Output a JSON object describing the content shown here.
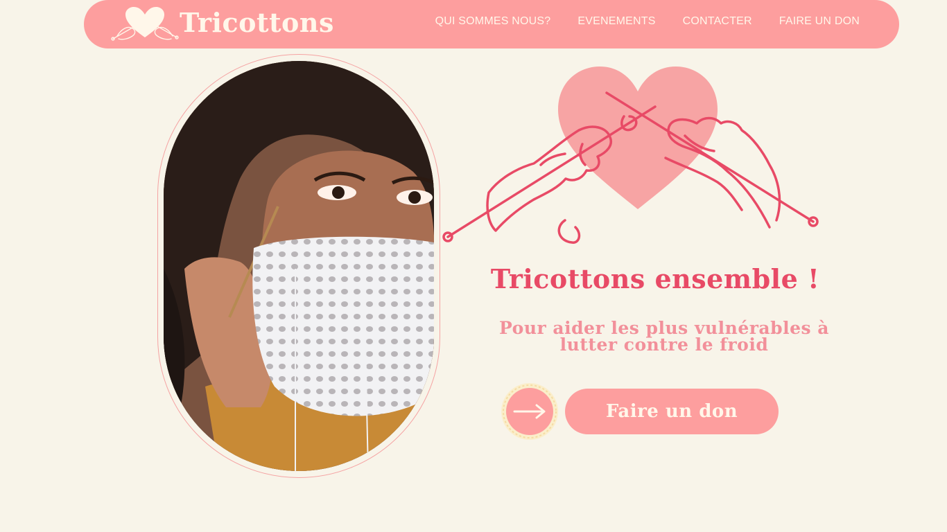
{
  "header": {
    "brand": "Tricottons",
    "nav": [
      {
        "label": "QUI SOMMES NOUS?"
      },
      {
        "label": "EVENEMENTS"
      },
      {
        "label": "CONTACTER"
      },
      {
        "label": "FAIRE UN DON"
      }
    ]
  },
  "hero": {
    "title": "Tricottons ensemble !",
    "subtitle": "Pour aider les plus vulnérables à lutter contre le froid",
    "cta_label": "Faire un don",
    "arrow_icon": "arrow-right-icon",
    "illustration_icon": "knitting-hands-heart-icon"
  },
  "colors": {
    "background": "#f8f4e9",
    "primary_pink": "#fd9e9e",
    "accent_red": "#e84a66",
    "light_pink": "#f2909a",
    "cream": "#fff7ea"
  }
}
